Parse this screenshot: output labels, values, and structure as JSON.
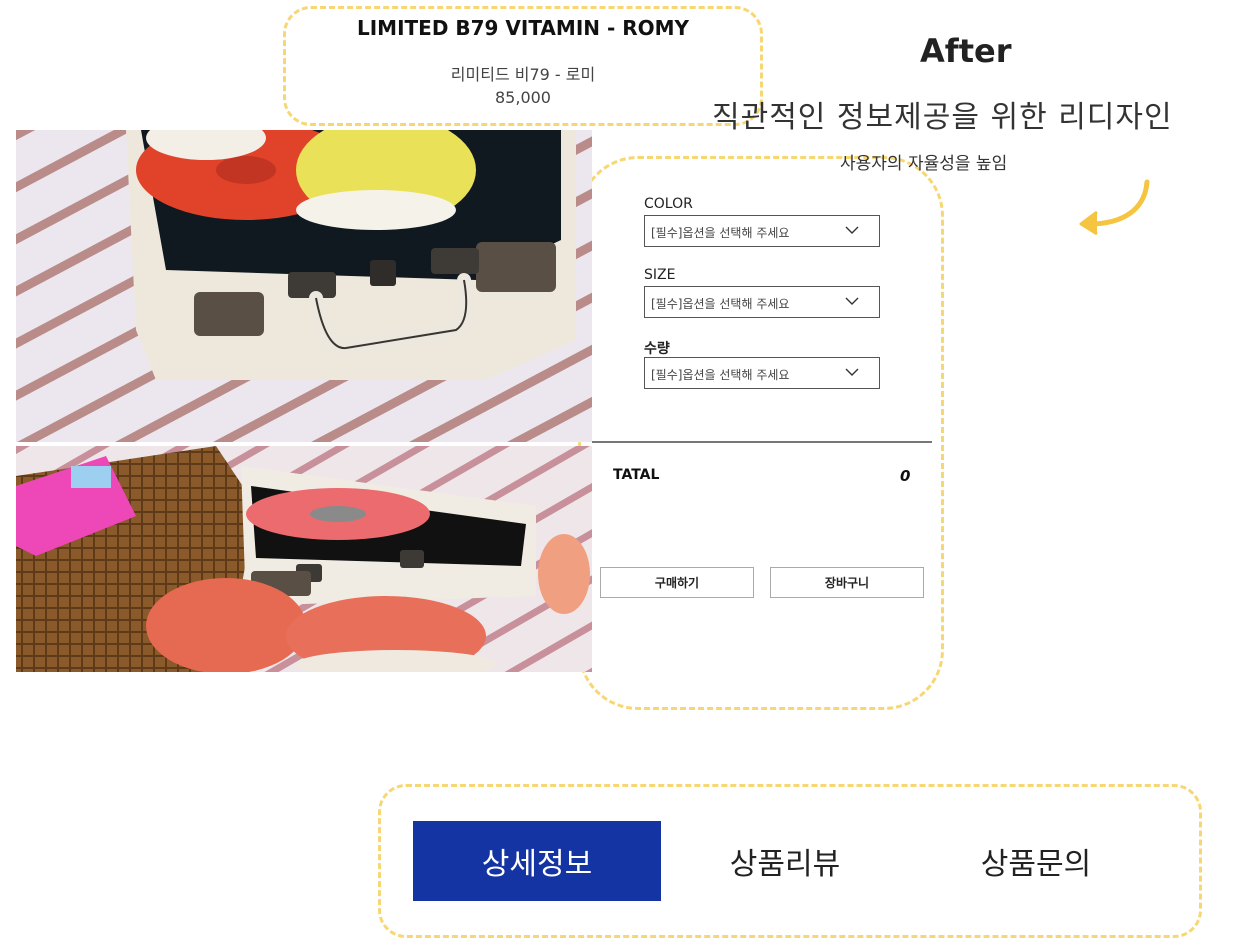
{
  "product": {
    "title": "LIMITED B79 VITAMIN - ROMY",
    "name_kr": "리미티드 비79 - 로미",
    "price": "85,000"
  },
  "annotation": {
    "after": "After",
    "headline": "직관적인 정보제공을 위한 리디자인",
    "subline": "사용자의 자율성을 높임",
    "highlight_color": "#f7d774"
  },
  "options": [
    {
      "label": "COLOR",
      "placeholder": "[필수]옵션을 선택해 주세요"
    },
    {
      "label": "SIZE",
      "placeholder": "[필수]옵션을 선택해 주세요"
    },
    {
      "label": "수량",
      "placeholder": "[필수]옵션을 선택해 주세요"
    }
  ],
  "total": {
    "label": "TATAL",
    "value": "0"
  },
  "buttons": {
    "buy": "구매하기",
    "cart": "장바구니"
  },
  "tabs": [
    {
      "label": "상세정보",
      "active": true
    },
    {
      "label": "상품리뷰",
      "active": false
    },
    {
      "label": "상품문의",
      "active": false
    }
  ],
  "colors": {
    "tab_active": "#1434a4"
  }
}
